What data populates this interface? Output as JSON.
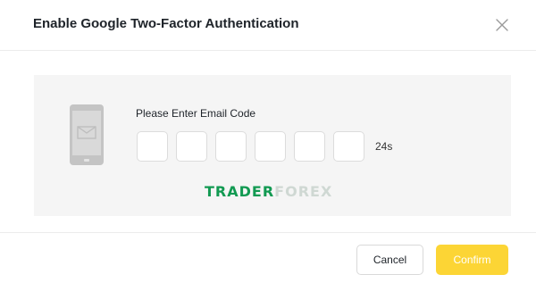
{
  "dialog": {
    "title": "Enable Google Two-Factor Authentication"
  },
  "verification": {
    "prompt": "Please Enter Email Code",
    "code_digits": [
      "",
      "",
      "",
      "",
      "",
      ""
    ],
    "countdown": "24s"
  },
  "watermark": {
    "part_a": "TRADER",
    "part_b": "FOREX"
  },
  "footer": {
    "cancel_label": "Cancel",
    "confirm_label": "Confirm"
  },
  "icons": {
    "close": "close-icon",
    "phone": "phone-email-icon"
  },
  "colors": {
    "confirm_bg": "#fcd535",
    "panel_bg": "#f5f5f5",
    "watermark_green": "#129a52"
  }
}
